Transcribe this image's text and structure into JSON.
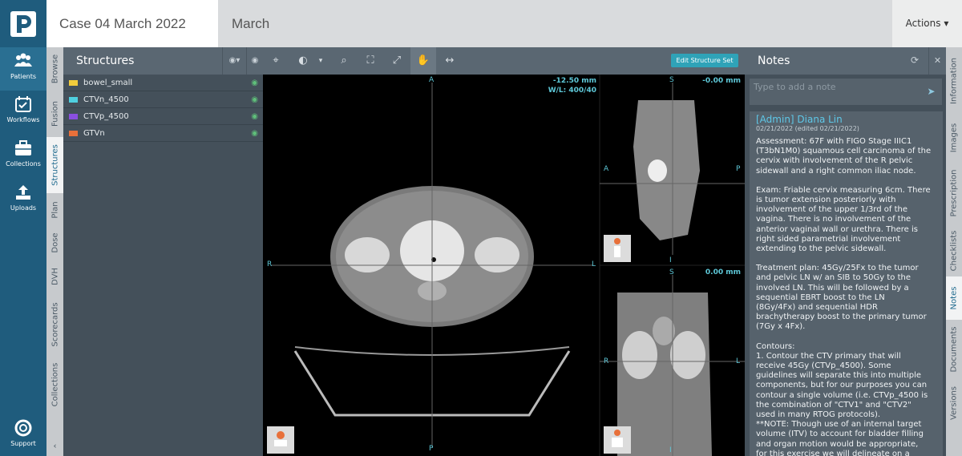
{
  "app": {
    "logo": "P"
  },
  "header": {
    "case_title": "Case 04 March 2022",
    "subtitle": "March",
    "actions_label": "Actions"
  },
  "nav": {
    "items": [
      {
        "label": "Patients",
        "icon": "users-icon"
      },
      {
        "label": "Workflows",
        "icon": "calendar-check-icon"
      },
      {
        "label": "Collections",
        "icon": "briefcase-icon"
      },
      {
        "label": "Uploads",
        "icon": "upload-icon"
      }
    ],
    "support_label": "Support"
  },
  "side_tabs": [
    "Browse",
    "Fusion",
    "Structures",
    "Plan",
    "Dose",
    "DVH",
    "Scorecards",
    "Collections"
  ],
  "structures": {
    "title": "Structures",
    "items": [
      {
        "name": "bowel_small",
        "color": "#f2cc3c"
      },
      {
        "name": "CTVn_4500",
        "color": "#4fd0e0"
      },
      {
        "name": "CTVp_4500",
        "color": "#8a4fe0"
      },
      {
        "name": "GTVn",
        "color": "#e8703a"
      }
    ]
  },
  "viewer": {
    "edit_button": "Edit Structure Set",
    "axial": {
      "top": "A",
      "bottom": "P",
      "left": "R",
      "right": "L",
      "slice": "-12.50 mm",
      "wl": "W/L: 400/40"
    },
    "sagittal": {
      "top": "S",
      "bottom": "I",
      "left": "A",
      "right": "P",
      "slice": "-0.00 mm"
    },
    "coronal": {
      "top": "S",
      "bottom": "I",
      "left": "R",
      "right": "L",
      "slice": "0.00 mm"
    }
  },
  "notes": {
    "title": "Notes",
    "placeholder": "Type to add a note",
    "author": "[Admin] Diana Lin",
    "date": "02/21/2022 (edited 02/21/2022)",
    "paragraphs": [
      "Assessment: 67F with FIGO Stage IIIC1\n(T3bN1M0) squamous cell carcinoma of the\ncervix with involvement of the R pelvic\nsidewall and a right common iliac node.",
      "Exam: Friable cervix measuring 6cm. There\nis tumor extension posteriorly with\ninvolvement of the upper 1/3rd of the\nvagina. There is no involvement of the\nanterior vaginal wall or urethra. There is\nright sided parametrial involvement\nextending to the pelvic sidewall.",
      "Treatment plan: 45Gy/25Fx to the tumor\nand pelvic LN w/ an SIB to 50Gy to the\ninvolved LN. This will be followed by a\nsequential EBRT boost to the LN\n(8Gy/4Fx) and sequential HDR\nbrachytherapy boost to the primary tumor\n(7Gy x 4Fx).",
      "Contours:\n1. Contour the CTV primary that will\nreceive 45Gy (CTVp_4500). Some\nguidelines will separate this into multiple\ncomponents, but for our purposes you can\ncontour a single volume (i.e. CTVp_4500 is\nthe combination of \"CTV1\" and \"CTV2\"\nused in many RTOG protocols).\n**NOTE: Though use of an internal target\nvolume (ITV) to account for bladder filling\nand organ motion would be appropriate,\nfor this exercise we will delineate on a"
    ]
  },
  "right_tabs": [
    "Information",
    "Images",
    "Prescription",
    "Checklists",
    "Notes",
    "Documents",
    "Versions"
  ]
}
